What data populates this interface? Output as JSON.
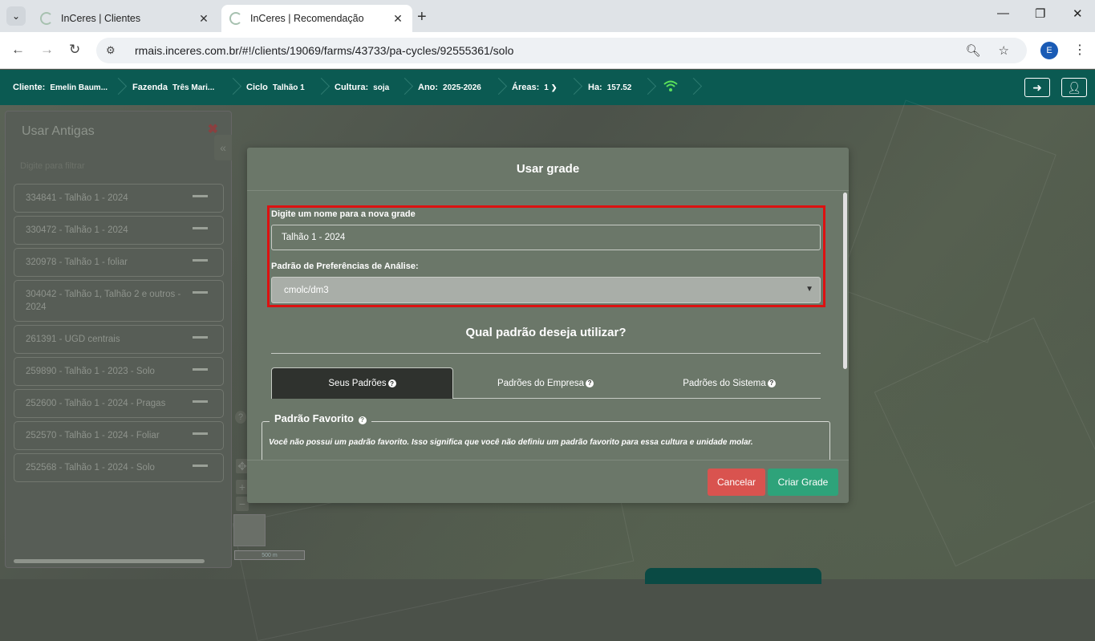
{
  "browser": {
    "tabs": [
      {
        "title": "InCeres | Clientes",
        "active": false
      },
      {
        "title": "InCeres | Recomendação",
        "active": true
      }
    ],
    "url": "rmais.inceres.com.br/#!/clients/19069/farms/43733/pa-cycles/92555361/solo",
    "profile_initial": "E"
  },
  "header": {
    "crumbs": [
      {
        "label": "Cliente:",
        "value": "Emelin Baum..."
      },
      {
        "label": "Fazenda",
        "value": "Três Mari..."
      },
      {
        "label": "Ciclo",
        "value": "Talhão 1"
      },
      {
        "label": "Cultura:",
        "value": "soja"
      },
      {
        "label": "Ano:",
        "value": "2025-2026"
      },
      {
        "label": "Áreas:",
        "value": "1"
      },
      {
        "label": "Ha:",
        "value": "157.52"
      }
    ],
    "status_color": "#5be05b",
    "brand_color": "#0b5a52"
  },
  "left_panel": {
    "title": "Usar Antigas",
    "filter_placeholder": "Digite para filtrar",
    "items": [
      "334841 - Talhão 1 - 2024",
      "330472 - Talhão 1 - 2024",
      "320978 - Talhão 1 - foliar",
      "304042 - Talhão 1, Talhão 2 e outros - 2024",
      "261391 - UGD centrais",
      "259890 - Talhão 1 - 2023 - Solo",
      "252600 - Talhão 1 - 2024 - Pragas",
      "252570 - Talhão 1 - 2024 - Foliar",
      "252568 - Talhão 1 - 2024 - Solo"
    ]
  },
  "map": {
    "scale": "500 m"
  },
  "modal": {
    "title": "Usar grade",
    "name_label": "Digite um nome para a nova grade",
    "name_value": "Talhão 1 - 2024",
    "pref_label": "Padrão de Preferências de Análise:",
    "pref_value": "cmolc/dm3",
    "question": "Qual padrão deseja utilizar?",
    "tabs": [
      "Seus Padrões",
      "Padrões do Empresa",
      "Padrões do Sistema"
    ],
    "favorite_title": "Padrão Favorito",
    "favorite_text": "Você não possui um padrão favorito. Isso significa que você não definiu um padrão favorito para essa cultura e unidade molar.",
    "cancel_label": "Cancelar",
    "create_label": "Criar Grade",
    "cancel_color": "#d9534f",
    "create_color": "#2ea37a"
  }
}
